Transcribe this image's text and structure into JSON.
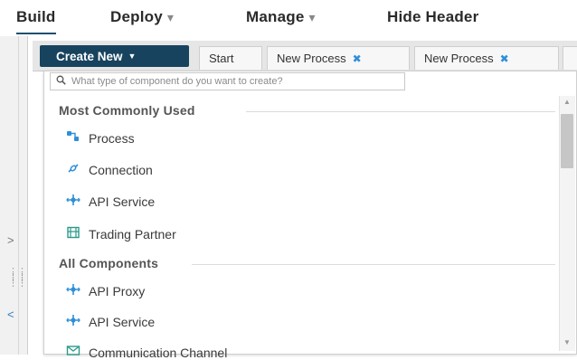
{
  "topnav": {
    "build": "Build",
    "deploy": "Deploy",
    "manage": "Manage",
    "hide_header": "Hide Header",
    "caret": "▾"
  },
  "toolbar": {
    "create_new": "Create New",
    "create_caret": "▼"
  },
  "tabs": [
    {
      "label": "Start"
    },
    {
      "label": "New Process",
      "close": "✖"
    },
    {
      "label": "New Process",
      "close": "✖"
    }
  ],
  "search": {
    "placeholder": "What type of component do you want to create?"
  },
  "sections": {
    "common": "Most Commonly Used",
    "all": "All Components"
  },
  "common_items": [
    {
      "label": "Process",
      "icon": "process-icon"
    },
    {
      "label": "Connection",
      "icon": "connection-icon"
    },
    {
      "label": "API Service",
      "icon": "api-service-icon"
    },
    {
      "label": "Trading Partner",
      "icon": "trading-partner-icon"
    }
  ],
  "all_items": [
    {
      "label": "API Proxy",
      "icon": "api-proxy-icon"
    },
    {
      "label": "API Service",
      "icon": "api-service-icon"
    },
    {
      "label": "Communication Channel",
      "icon": "communication-channel-icon"
    }
  ],
  "colors": {
    "create_button": "#17435f",
    "accent_blue": "#2f8fd8",
    "tab_strip": "#e6e6e6"
  }
}
